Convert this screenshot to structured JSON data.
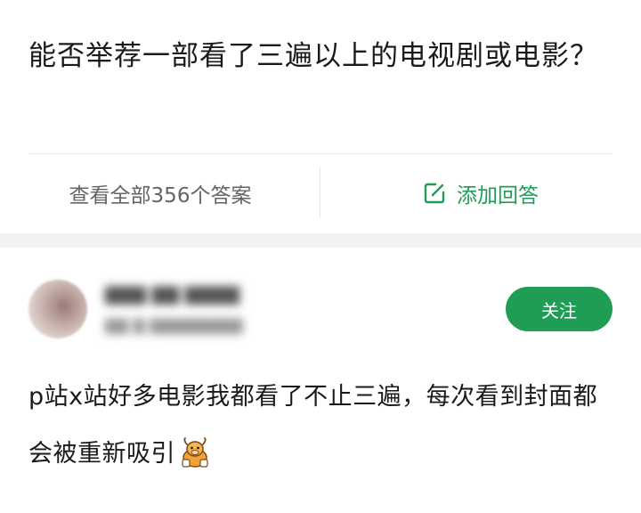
{
  "question": {
    "title": "能否举荐一部看了三遍以上的电视剧或电影？",
    "view_all_label": "查看全部356个答案",
    "add_answer_label": "添加回答",
    "add_answer_icon": "edit-icon"
  },
  "answer": {
    "author_name": "▇▇▇ ▇▇ ▇▇▇▇",
    "author_meta": "▇▇ ▇ ▇▇▇▇▇▇▇▇",
    "follow_label": "关注",
    "text": "p站x站好多电影我都看了不止三遍，每次看到封面都会被重新吸引",
    "emoji": "cow-emoji-icon"
  },
  "colors": {
    "accent": "#1f9d55",
    "divider": "#e6e6e6",
    "band": "#f2f2f2",
    "text": "#1a1a1a",
    "secondary_text": "#646464"
  }
}
